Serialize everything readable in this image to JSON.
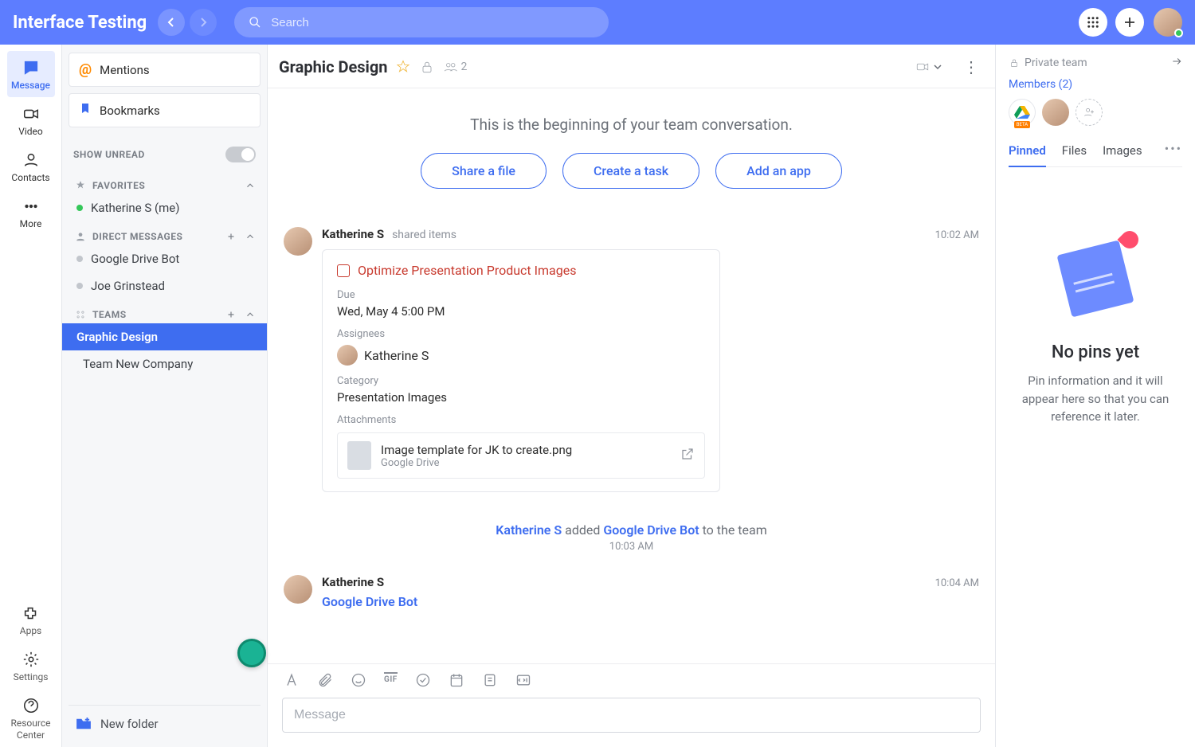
{
  "header": {
    "app_title": "Interface Testing",
    "search_placeholder": "Search"
  },
  "rail": {
    "message": "Message",
    "video": "Video",
    "contacts": "Contacts",
    "more": "More",
    "apps": "Apps",
    "settings": "Settings",
    "resource_center": "Resource Center"
  },
  "sidebar": {
    "mentions": "Mentions",
    "bookmarks": "Bookmarks",
    "show_unread": "SHOW UNREAD",
    "favorites_header": "FAVORITES",
    "fav_items": [
      {
        "name": "Katherine S (me)",
        "online": true
      }
    ],
    "dm_header": "DIRECT MESSAGES",
    "dm_items": [
      {
        "name": "Google Drive Bot",
        "online": false
      },
      {
        "name": "Joe Grinstead",
        "online": false
      }
    ],
    "teams_header": "TEAMS",
    "team_items": [
      {
        "name": "Graphic Design",
        "active": true
      },
      {
        "name": "Team New Company",
        "active": false
      }
    ],
    "new_folder": "New folder"
  },
  "chat": {
    "title": "Graphic Design",
    "member_count": "2",
    "beginning": "This is the beginning of your team conversation.",
    "chips": {
      "share": "Share a file",
      "task": "Create a task",
      "app": "Add an app"
    },
    "msg1": {
      "author": "Katherine S",
      "sub": "shared items",
      "time": "10:02 AM",
      "task": {
        "title": "Optimize Presentation Product Images",
        "due_label": "Due",
        "due_value": "Wed, May 4 5:00 PM",
        "assignees_label": "Assignees",
        "assignee_name": "Katherine S",
        "category_label": "Category",
        "category_value": "Presentation Images",
        "attachments_label": "Attachments",
        "file_title": "Image template for JK to create.png",
        "file_source": "Google Drive"
      }
    },
    "system": {
      "actor": "Katherine S",
      "text": " added ",
      "target": "Google Drive Bot",
      "suffix": " to the team",
      "time": "10:03 AM"
    },
    "msg2": {
      "author": "Katherine S",
      "time": "10:04 AM",
      "link": "Google Drive Bot"
    },
    "composer_placeholder": "Message"
  },
  "rpanel": {
    "private_team": "Private team",
    "members_label": "Members (2)",
    "tabs": {
      "pinned": "Pinned",
      "files": "Files",
      "images": "Images"
    },
    "empty_title": "No pins yet",
    "empty_text": "Pin information and it will appear here so that you can reference it later."
  }
}
